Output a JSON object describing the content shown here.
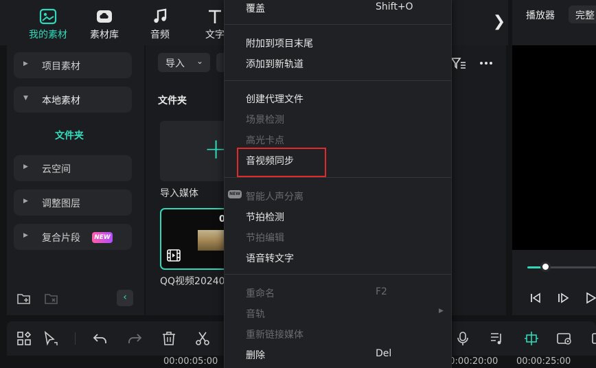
{
  "top_tabs": [
    {
      "label": "我的素材",
      "icon": "media-icon",
      "active": true
    },
    {
      "label": "素材库",
      "icon": "cloud-library-icon",
      "active": false
    },
    {
      "label": "音频",
      "icon": "music-note-icon",
      "active": false
    },
    {
      "label": "文字",
      "icon": "text-icon",
      "active": false
    }
  ],
  "top_next": "❯",
  "sidebar": {
    "items": [
      {
        "label": "项目素材",
        "arrow": "▶"
      },
      {
        "label": "本地素材",
        "arrow": "▼"
      },
      {
        "label": "云空间",
        "arrow": "▶"
      },
      {
        "label": "调整图层",
        "arrow": "▶"
      },
      {
        "label": "复合片段",
        "arrow": "▶"
      }
    ],
    "subitem": "文件夹",
    "new_badge": "NEW",
    "collapse": "‹"
  },
  "media": {
    "import_label": "导入",
    "import_dropdown": "⌄",
    "folder_title": "文件夹",
    "import_tile_label": "导入媒体",
    "import_plus": "+",
    "clip_duration": "0",
    "clip_name": "QQ视频20240"
  },
  "player": {
    "tab_label": "播放器",
    "mode_label": "完整",
    "progress": 0.26
  },
  "context_menu": {
    "items": [
      {
        "label": "覆盖",
        "shortcut": "Shift+O",
        "disabled": false
      },
      {
        "label": "附加到项目末尾",
        "disabled": false
      },
      {
        "label": "添加到新轨道",
        "disabled": false
      },
      {
        "label": "创建代理文件",
        "disabled": false
      },
      {
        "label": "场景检测",
        "disabled": true
      },
      {
        "label": "高光卡点",
        "disabled": true
      },
      {
        "label": "音视频同步",
        "disabled": false
      },
      {
        "label": "智能人声分离",
        "disabled": true
      },
      {
        "label": "节拍检测",
        "disabled": false
      },
      {
        "label": "节拍编辑",
        "disabled": true
      },
      {
        "label": "语音转文字",
        "disabled": false
      },
      {
        "label": "重命名",
        "shortcut": "F2",
        "disabled": true
      },
      {
        "label": "音轨",
        "disabled": true
      },
      {
        "label": "重新链接媒体",
        "disabled": true
      },
      {
        "label": "删除",
        "shortcut": "Del",
        "disabled": false
      }
    ],
    "new_badge": "NEW",
    "submenu_arrow": "▶",
    "highlight_color": "#e02b2b"
  },
  "timeline": {
    "ruler": [
      "00:00:05:00",
      "00:00:20:00",
      "00:00:25:00"
    ]
  },
  "colors": {
    "accent": "#2fd9b9",
    "background": "#131416",
    "panel": "#1c1d20",
    "menu": "#202124"
  }
}
